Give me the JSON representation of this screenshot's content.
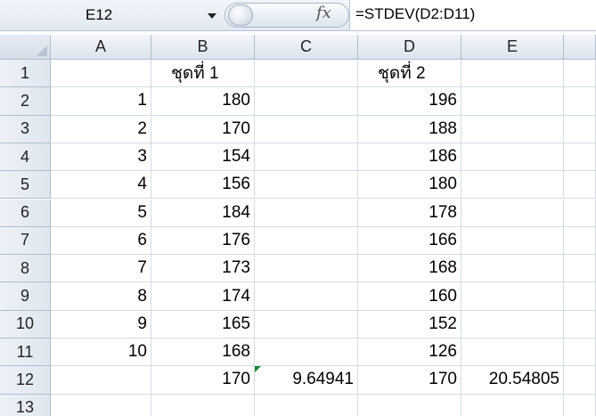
{
  "formula_bar": {
    "name_box": "E12",
    "fx_label": "fx",
    "formula": "=STDEV(D2:D11)"
  },
  "columns": [
    "A",
    "B",
    "C",
    "D",
    "E"
  ],
  "rows": [
    {
      "n": "1",
      "A": "",
      "B": "ชุดที่ 1",
      "C": "",
      "D": "ชุดที่ 2",
      "E": ""
    },
    {
      "n": "2",
      "A": "1",
      "B": "180",
      "C": "",
      "D": "196",
      "E": ""
    },
    {
      "n": "3",
      "A": "2",
      "B": "170",
      "C": "",
      "D": "188",
      "E": ""
    },
    {
      "n": "4",
      "A": "3",
      "B": "154",
      "C": "",
      "D": "186",
      "E": ""
    },
    {
      "n": "5",
      "A": "4",
      "B": "156",
      "C": "",
      "D": "180",
      "E": ""
    },
    {
      "n": "6",
      "A": "5",
      "B": "184",
      "C": "",
      "D": "178",
      "E": ""
    },
    {
      "n": "7",
      "A": "6",
      "B": "176",
      "C": "",
      "D": "166",
      "E": ""
    },
    {
      "n": "8",
      "A": "7",
      "B": "173",
      "C": "",
      "D": "168",
      "E": ""
    },
    {
      "n": "9",
      "A": "8",
      "B": "174",
      "C": "",
      "D": "160",
      "E": ""
    },
    {
      "n": "10",
      "A": "9",
      "B": "165",
      "C": "",
      "D": "152",
      "E": ""
    },
    {
      "n": "11",
      "A": "10",
      "B": "168",
      "C": "",
      "D": "126",
      "E": ""
    },
    {
      "n": "12",
      "A": "",
      "B": "170",
      "C": "9.64941",
      "D": "170",
      "E": "20.54805"
    },
    {
      "n": "13",
      "A": "",
      "B": "",
      "C": "",
      "D": "",
      "E": ""
    }
  ],
  "colors": {
    "error_indicator": "#1c8a2e",
    "header_bg": "#dde4ee",
    "gridline": "#d4dbe5"
  }
}
